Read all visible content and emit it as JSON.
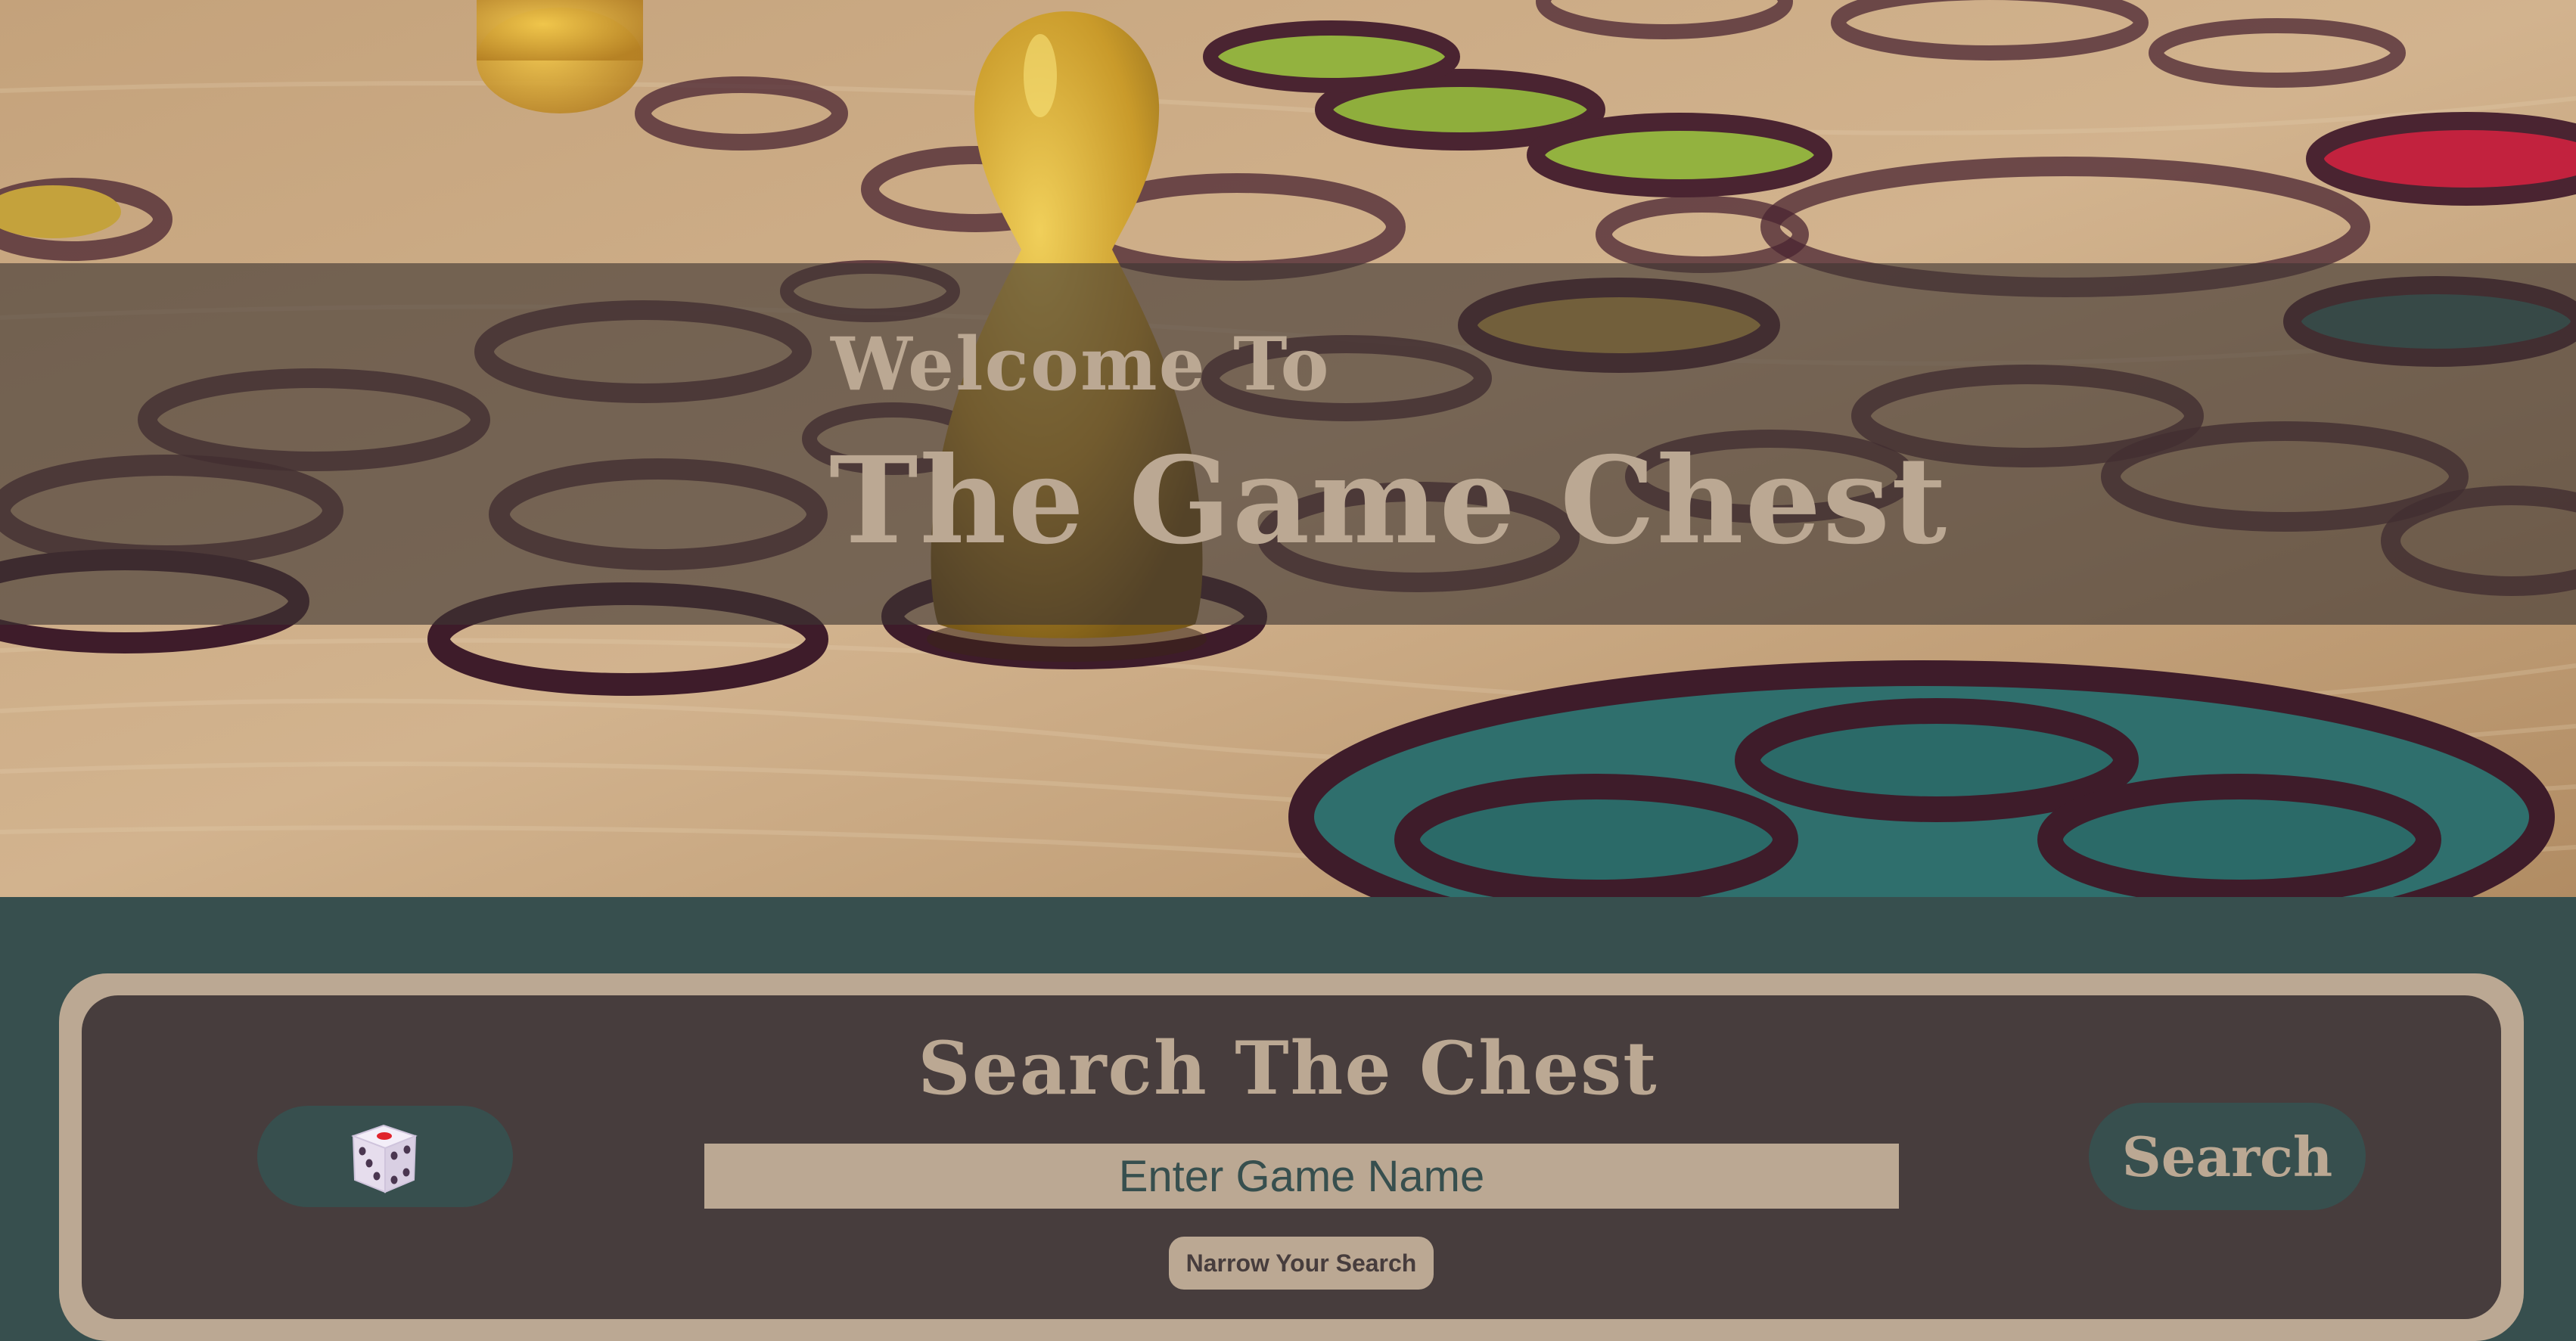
{
  "hero": {
    "welcome": "Welcome To",
    "title": "The Game Chest",
    "background_image": "wooden board game with pawn"
  },
  "search": {
    "heading": "Search The Chest",
    "placeholder": "Enter Game Name",
    "value": "",
    "search_label": "Search",
    "narrow_label": "Narrow Your Search",
    "random_icon": "dice-icon"
  },
  "colors": {
    "page_background": "#374f4e",
    "panel_border": "#bba893",
    "panel_background": "#473d3d",
    "accent_text": "#bba893",
    "button_background": "#374f4e",
    "banner_overlay": "rgba(62,54,50,0.62)"
  }
}
